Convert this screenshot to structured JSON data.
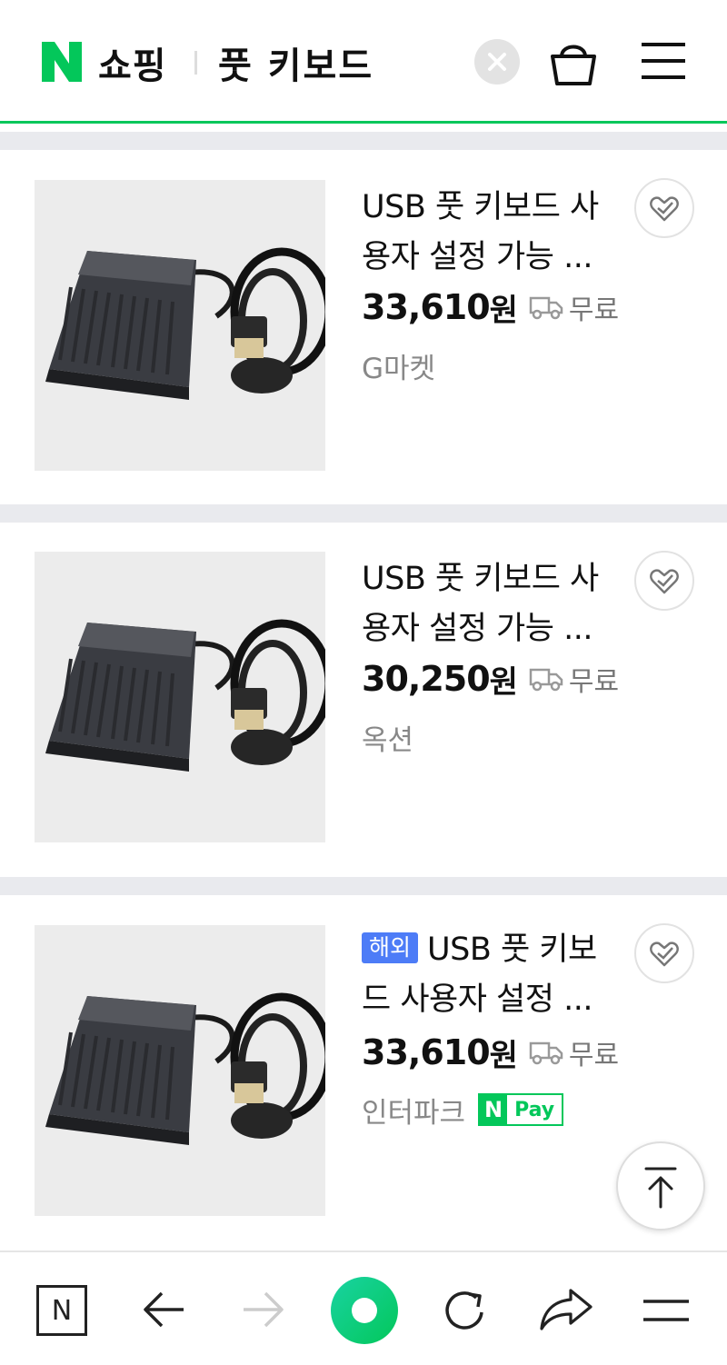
{
  "header": {
    "brand": "쇼핑",
    "query": "풋 키보드",
    "logo_letter": "N"
  },
  "products": [
    {
      "title_line1": "USB 풋 키보드 사",
      "title_line2": "용자 설정 가능 ...",
      "price": "33,610",
      "currency": "원",
      "shipping": "무료",
      "seller": "G마켓"
    },
    {
      "title_line1": "USB 풋 키보드 사",
      "title_line2": "용자 설정 가능 ...",
      "price": "30,250",
      "currency": "원",
      "shipping": "무료",
      "seller": "옥션"
    },
    {
      "badge": "해외",
      "title_line1": "USB 풋 키보",
      "title_line2": "드 사용자 설정 ...",
      "price": "33,610",
      "currency": "원",
      "shipping": "무료",
      "seller": "인터파크",
      "pay_badge": {
        "letter": "N",
        "text": "Pay"
      }
    }
  ],
  "bottom_nav": {
    "home_letter": "N"
  },
  "colors": {
    "naver_green": "#03c75a",
    "overseas_badge": "#4d7cf7",
    "separator": "#e9eaee"
  },
  "icons": [
    "close-icon",
    "shopping-bag-icon",
    "menu-icon",
    "truck-icon",
    "heart-check-icon",
    "scroll-top-icon",
    "back-arrow-icon",
    "forward-arrow-icon",
    "green-circle-icon",
    "refresh-icon",
    "share-icon"
  ]
}
